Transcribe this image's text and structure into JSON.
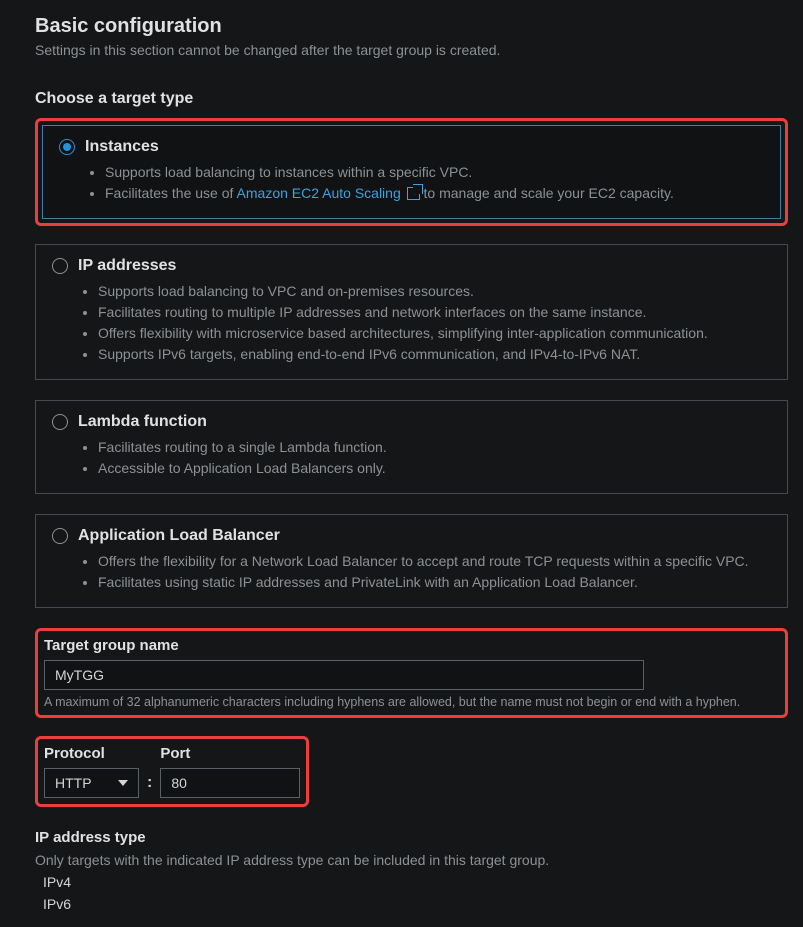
{
  "header": {
    "title": "Basic configuration",
    "subtitle": "Settings in this section cannot be changed after the target group is created."
  },
  "targetType": {
    "heading": "Choose a target type",
    "options": [
      {
        "key": "instances",
        "label": "Instances",
        "selected": true,
        "bullets": [
          "Supports load balancing to instances within a specific VPC.",
          "Facilitates the use of"
        ],
        "link": {
          "text": "Amazon EC2 Auto Scaling"
        },
        "afterLink": "to manage and scale your EC2 capacity."
      },
      {
        "key": "ip",
        "label": "IP addresses",
        "selected": false,
        "bullets": [
          "Supports load balancing to VPC and on-premises resources.",
          "Facilitates routing to multiple IP addresses and network interfaces on the same instance.",
          "Offers flexibility with microservice based architectures, simplifying inter-application communication.",
          "Supports IPv6 targets, enabling end-to-end IPv6 communication, and IPv4-to-IPv6 NAT."
        ]
      },
      {
        "key": "lambda",
        "label": "Lambda function",
        "selected": false,
        "bullets": [
          "Facilitates routing to a single Lambda function.",
          "Accessible to Application Load Balancers only."
        ]
      },
      {
        "key": "alb",
        "label": "Application Load Balancer",
        "selected": false,
        "bullets": [
          "Offers the flexibility for a Network Load Balancer to accept and route TCP requests within a specific VPC.",
          "Facilitates using static IP addresses and PrivateLink with an Application Load Balancer."
        ]
      }
    ]
  },
  "nameField": {
    "label": "Target group name",
    "value": "MyTGG",
    "helper": "A maximum of 32 alphanumeric characters including hyphens are allowed, but the name must not begin or end with a hyphen."
  },
  "protocolPort": {
    "protocolLabel": "Protocol",
    "protocolValue": "HTTP",
    "portLabel": "Port",
    "portValue": "80"
  },
  "ipType": {
    "label": "IP address type",
    "helper": "Only targets with the indicated IP address type can be included in this target group.",
    "options": [
      {
        "label": "IPv4",
        "selected": true
      },
      {
        "label": "IPv6",
        "selected": false
      }
    ]
  }
}
